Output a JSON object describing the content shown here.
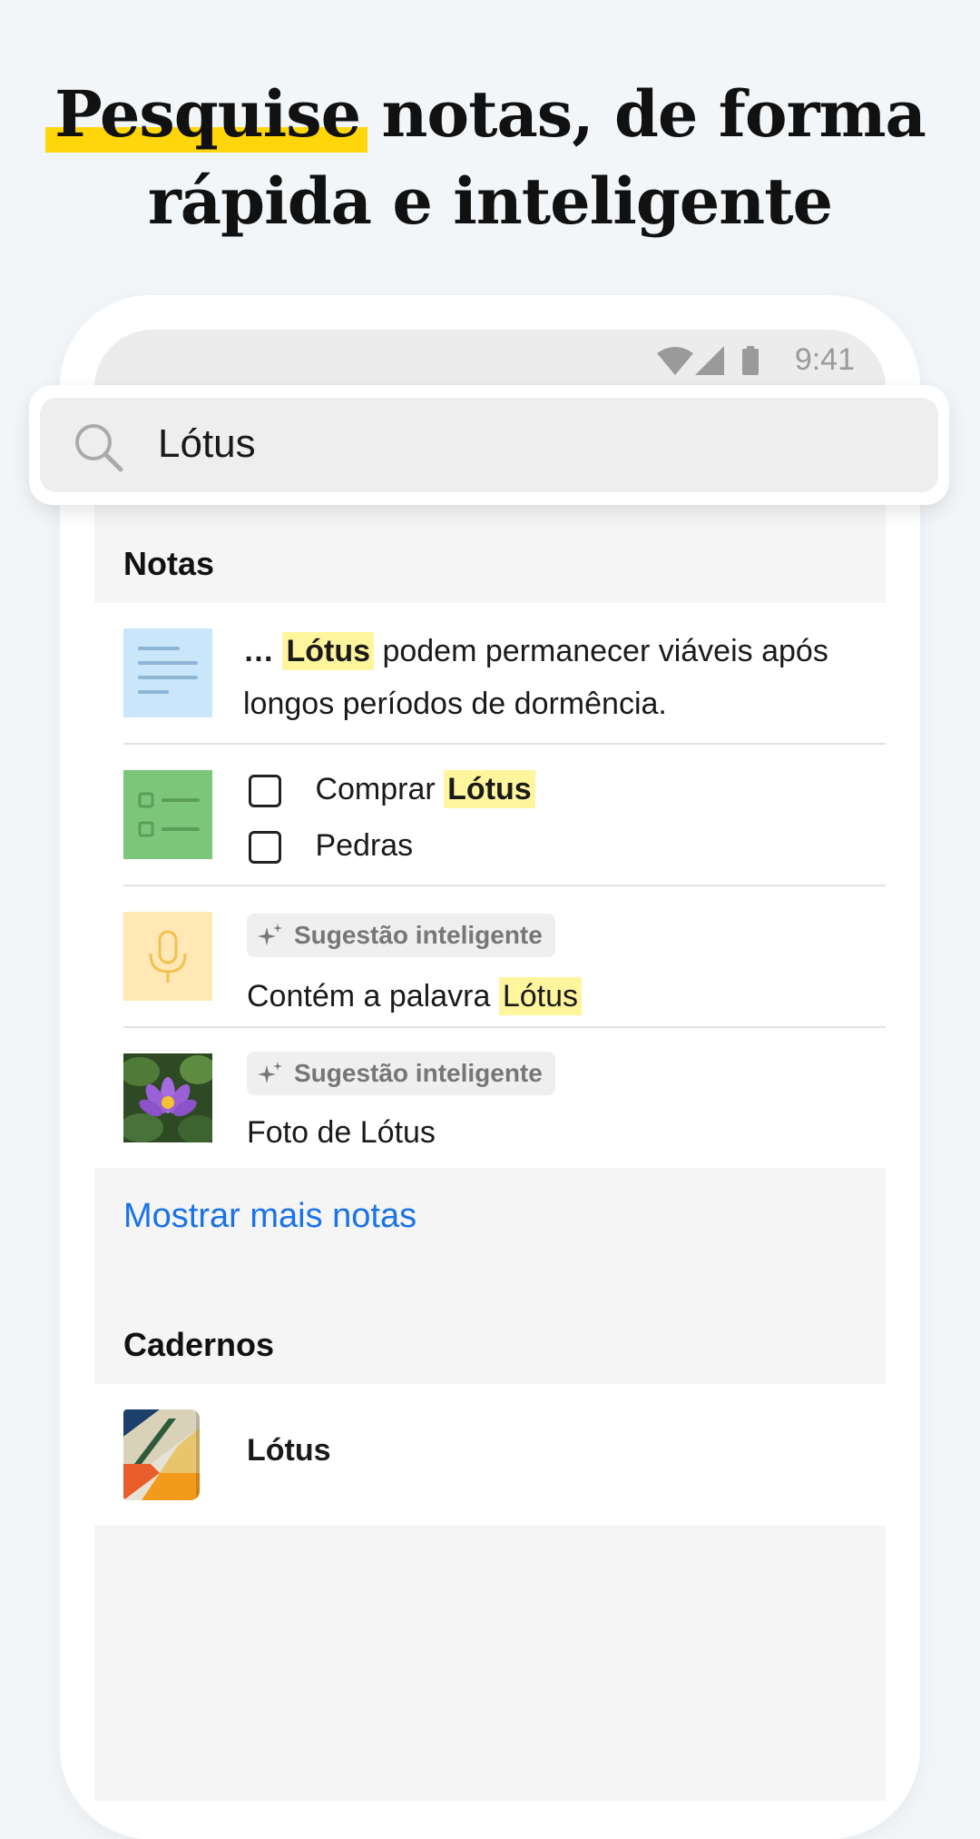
{
  "headline": {
    "highlight_word": "Pesquise",
    "line1_rest": " notas, de forma",
    "line2": "rápida e inteligente"
  },
  "status_bar": {
    "time": "9:41"
  },
  "search": {
    "query": "Lótus"
  },
  "sections": {
    "notes_title": "Notas",
    "notebooks_title": "Cadernos"
  },
  "notes": [
    {
      "type": "text",
      "prefix": "… ",
      "highlight": "Lótus",
      "text_rest": " podem permanecer viáveis após",
      "line2": "longos períodos de dormência."
    },
    {
      "type": "checklist",
      "item1_prefix": "Comprar ",
      "item1_highlight": "Lótus",
      "item2": "Pedras"
    },
    {
      "type": "audio",
      "chip": "Sugestão inteligente",
      "text_prefix": "Contém a palavra ",
      "highlight": "Lótus"
    },
    {
      "type": "photo",
      "chip": "Sugestão inteligente",
      "text": "Foto de Lótus"
    }
  ],
  "show_more": "Mostrar mais notas",
  "notebook": {
    "name": "Lótus"
  },
  "colors": {
    "highlight_yellow": "#ffd60a",
    "match_highlight": "#fff59d",
    "link_blue": "#1a73e8",
    "text_note_thumb": "#c9e6fb",
    "checklist_thumb": "#7cc67a",
    "audio_thumb": "#ffe8b5"
  }
}
